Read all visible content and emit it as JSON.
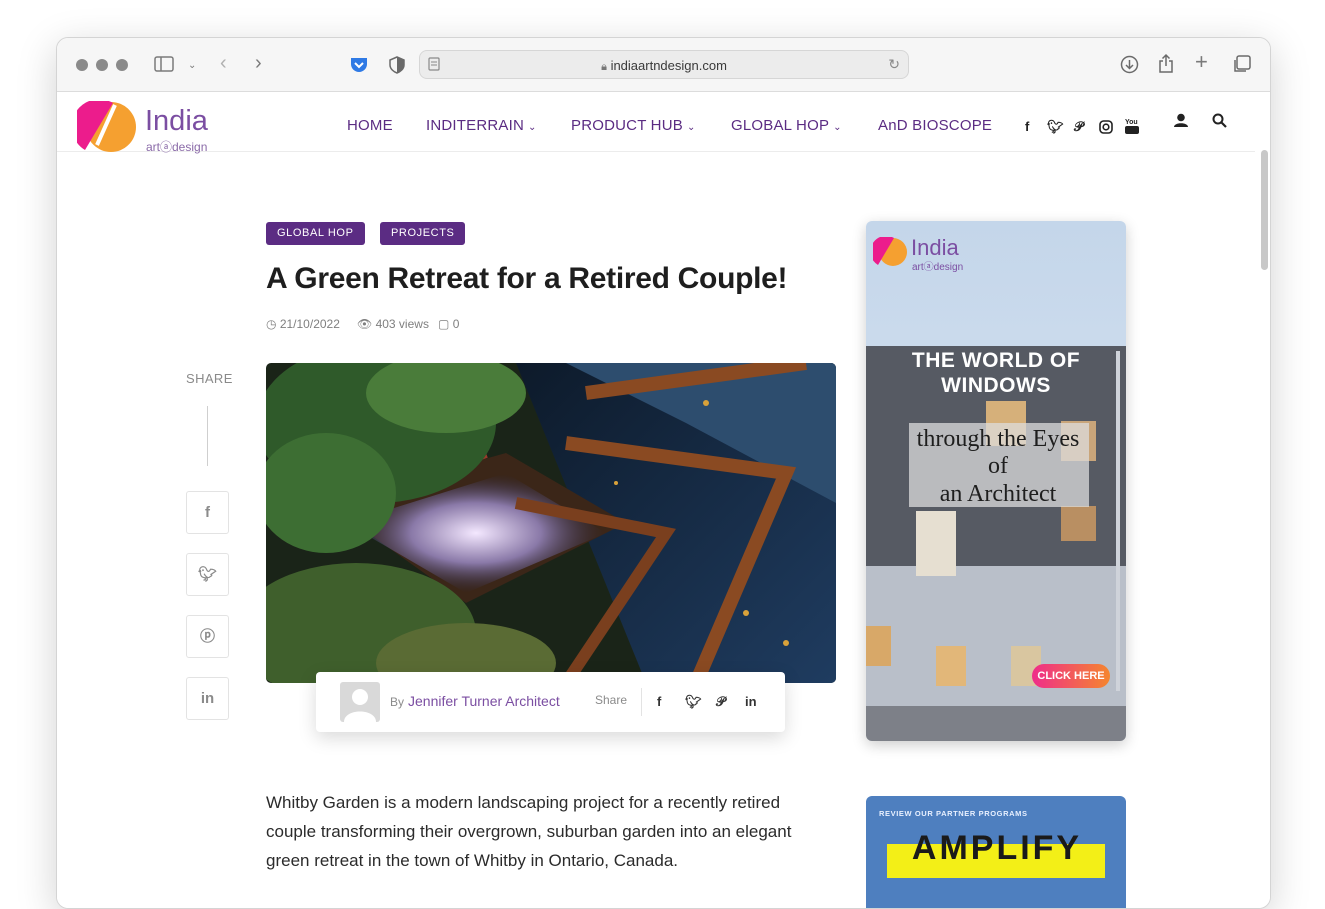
{
  "browser": {
    "url": "indiaartndesign.com"
  },
  "site": {
    "logo_main": "India",
    "logo_sub": "artⓐdesign",
    "nav": [
      {
        "label": "HOME",
        "has_dropdown": false
      },
      {
        "label": "INDITERRAIN",
        "has_dropdown": true
      },
      {
        "label": "PRODUCT HUB",
        "has_dropdown": true
      },
      {
        "label": "GLOBAL HOP",
        "has_dropdown": true
      },
      {
        "label": "AnD BIOSCOPE",
        "has_dropdown": false
      }
    ],
    "social_icons": [
      "facebook-icon",
      "twitter-icon",
      "pinterest-icon",
      "instagram-icon",
      "youtube-icon"
    ],
    "accent_color": "#5b2c83"
  },
  "article": {
    "tags": [
      "GLOBAL HOP",
      "PROJECTS"
    ],
    "title": "A Green Retreat for a Retired Couple!",
    "date": "21/10/2022",
    "views": "403 views",
    "comments": "0",
    "share_label": "SHARE",
    "author_prefix": "By",
    "author": "Jennifer Turner Architect",
    "share_text": "Share",
    "body": "Whitby Garden is a modern landscaping project for a recently retired couple transforming their overgrown, suburban garden into an elegant green retreat in the town of Whitby in Ontario, Canada."
  },
  "ads": {
    "ad1": {
      "logo_main": "India",
      "logo_sub": "artⓐdesign",
      "headline_line1": "THE WORLD OF",
      "headline_line2": "WINDOWS",
      "sub_line1": "through the Eyes",
      "sub_line2": "of",
      "sub_line3": "an Architect",
      "cta": "CLICK HERE"
    },
    "ad2": {
      "kicker": "REVIEW OUR PARTNER PROGRAMS",
      "headline": "AMPLIFY"
    }
  }
}
